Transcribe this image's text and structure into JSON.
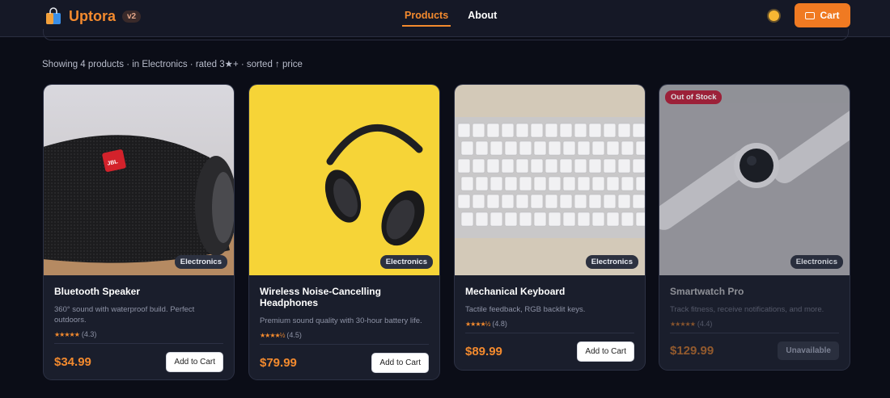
{
  "header": {
    "brand": "Uptora",
    "version": "v2",
    "nav": [
      "Products",
      "About"
    ],
    "cart_label": "Cart"
  },
  "summary": "Showing 4 products · in Electronics · rated 3★+ · sorted ↑ price",
  "products": [
    {
      "title": "Bluetooth Speaker",
      "description": "360° sound with waterproof build. Perfect outdoors.",
      "stars": "★★★★★",
      "rating": "(4.3)",
      "price": "$34.99",
      "category": "Electronics",
      "button": "Add to Cart"
    },
    {
      "title": "Wireless Noise-Cancelling Headphones",
      "description": "Premium sound quality with 30-hour battery life.",
      "stars": "★★★★½",
      "rating": "(4.5)",
      "price": "$79.99",
      "category": "Electronics",
      "button": "Add to Cart"
    },
    {
      "title": "Mechanical Keyboard",
      "description": "Tactile feedback, RGB backlit keys.",
      "stars": "★★★★½",
      "rating": "(4.8)",
      "price": "$89.99",
      "category": "Electronics",
      "button": "Add to Cart"
    },
    {
      "title": "Smartwatch Pro",
      "description": "Track fitness, receive notifications, and more.",
      "stars": "★★★★★",
      "rating": "(4.4)",
      "price": "$129.99",
      "category": "Electronics",
      "button": "Unavailable",
      "badge": "Out of Stock"
    }
  ],
  "colors": {
    "accent": "#f38a2e",
    "background": "#0b0d17",
    "card": "#1a1e2c",
    "out_of_stock": "#b4233c"
  },
  "icons": [
    "shopping-bag-icon",
    "sun-icon",
    "cart-icon"
  ]
}
